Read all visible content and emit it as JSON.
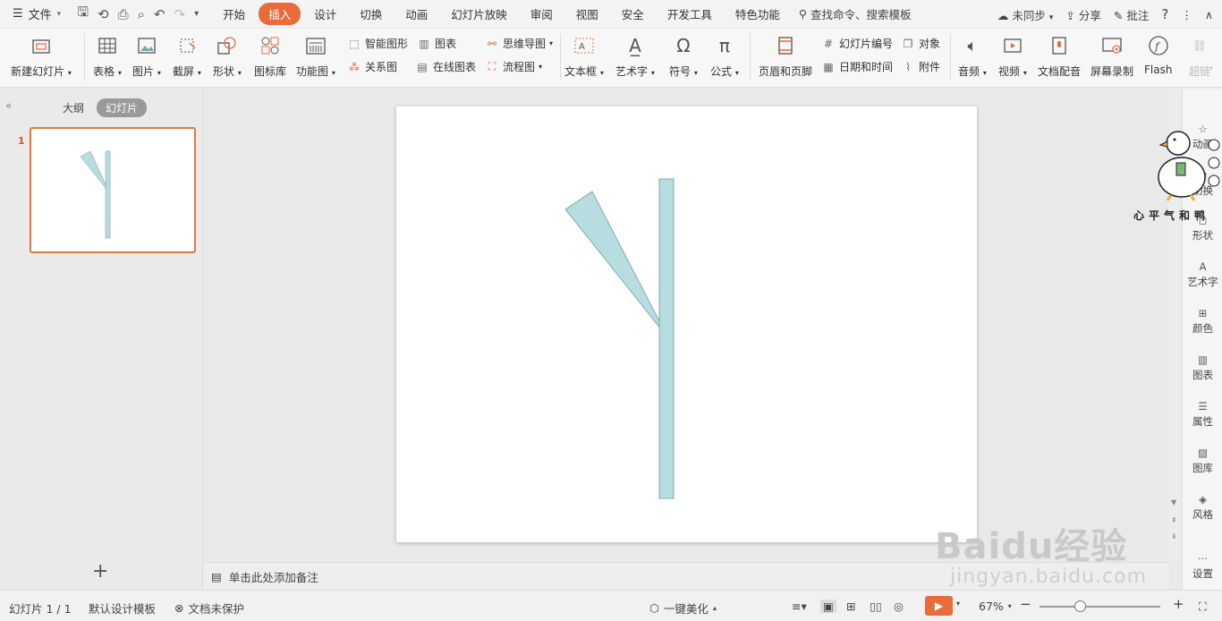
{
  "menu": {
    "file_label": "文件",
    "tabs": [
      "开始",
      "插入",
      "设计",
      "切换",
      "动画",
      "幻灯片放映",
      "审阅",
      "视图",
      "安全",
      "开发工具",
      "特色功能"
    ],
    "active_tab": "插入",
    "search_label": "查找命令、搜索模板",
    "sync_label": "未同步",
    "share_label": "分享",
    "comment_label": "批注"
  },
  "ribbon": {
    "new_slide": "新建幻灯片",
    "table": "表格",
    "picture": "图片",
    "screenshot": "截屏",
    "shape": "形状",
    "icon_lib": "图标库",
    "func_chart": "功能图",
    "smart_art": "智能图形",
    "chart": "图表",
    "relation": "关系图",
    "online_chart": "在线图表",
    "mind_map": "思维导图",
    "flowchart": "流程图",
    "textbox": "文本框",
    "art_text": "艺术字",
    "symbol": "符号",
    "formula": "公式",
    "header_footer": "页眉和页脚",
    "slide_number": "幻灯片编号",
    "object": "对象",
    "date_time": "日期和时间",
    "attachment": "附件",
    "audio": "音频",
    "video": "视频",
    "doc_voice": "文档配音",
    "screen_record": "屏幕录制",
    "flash": "Flash",
    "hyperlink": "超链"
  },
  "left_panel": {
    "outline_tab": "大纲",
    "slides_tab": "幻灯片",
    "slide_number": "1"
  },
  "notes_placeholder": "单击此处添加备注",
  "right_sidebar": [
    "动画",
    "切换",
    "形状",
    "艺术字",
    "颜色",
    "图表",
    "属性",
    "图库",
    "风格",
    "设置"
  ],
  "sticker_text": "心平气和鸭",
  "watermark": {
    "brand": "Baidu经验",
    "url": "jingyan.baidu.com"
  },
  "status": {
    "slide_info": "幻灯片 1 / 1",
    "template": "默认设计模板",
    "protection": "文档未保护",
    "beautify": "一键美化",
    "zoom": "67%"
  },
  "colors": {
    "accent": "#e76c3a",
    "shape_fill": "#b7dde0",
    "shape_stroke": "#6f9aa0"
  }
}
